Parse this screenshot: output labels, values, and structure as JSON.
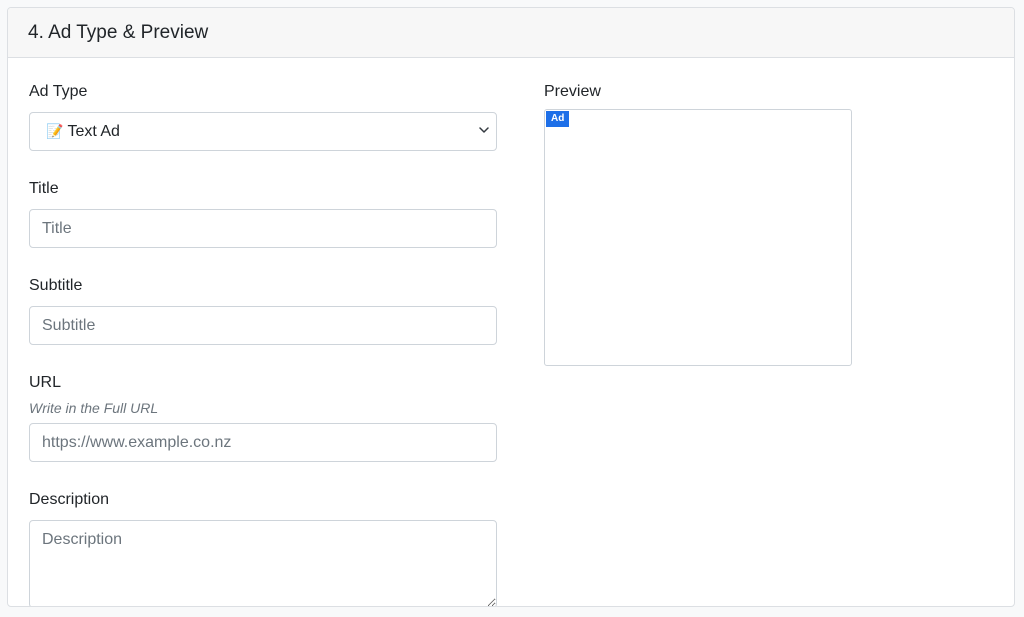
{
  "section": {
    "title": "4. Ad Type & Preview"
  },
  "ad_type": {
    "label": "Ad Type",
    "selected_icon": "memo-icon",
    "selected_emoji": "📝",
    "selected_value": "Text Ad"
  },
  "title_field": {
    "label": "Title",
    "placeholder": "Title"
  },
  "subtitle_field": {
    "label": "Subtitle",
    "placeholder": "Subtitle"
  },
  "url_field": {
    "label": "URL",
    "hint": "Write in the Full URL",
    "placeholder": "https://www.example.co.nz"
  },
  "description_field": {
    "label": "Description",
    "placeholder": "Description"
  },
  "preview": {
    "label": "Preview",
    "badge": "Ad"
  },
  "colors": {
    "badge_blue": "#1d6fe8",
    "border": "#ced4da",
    "header_bg": "#f7f7f7"
  }
}
